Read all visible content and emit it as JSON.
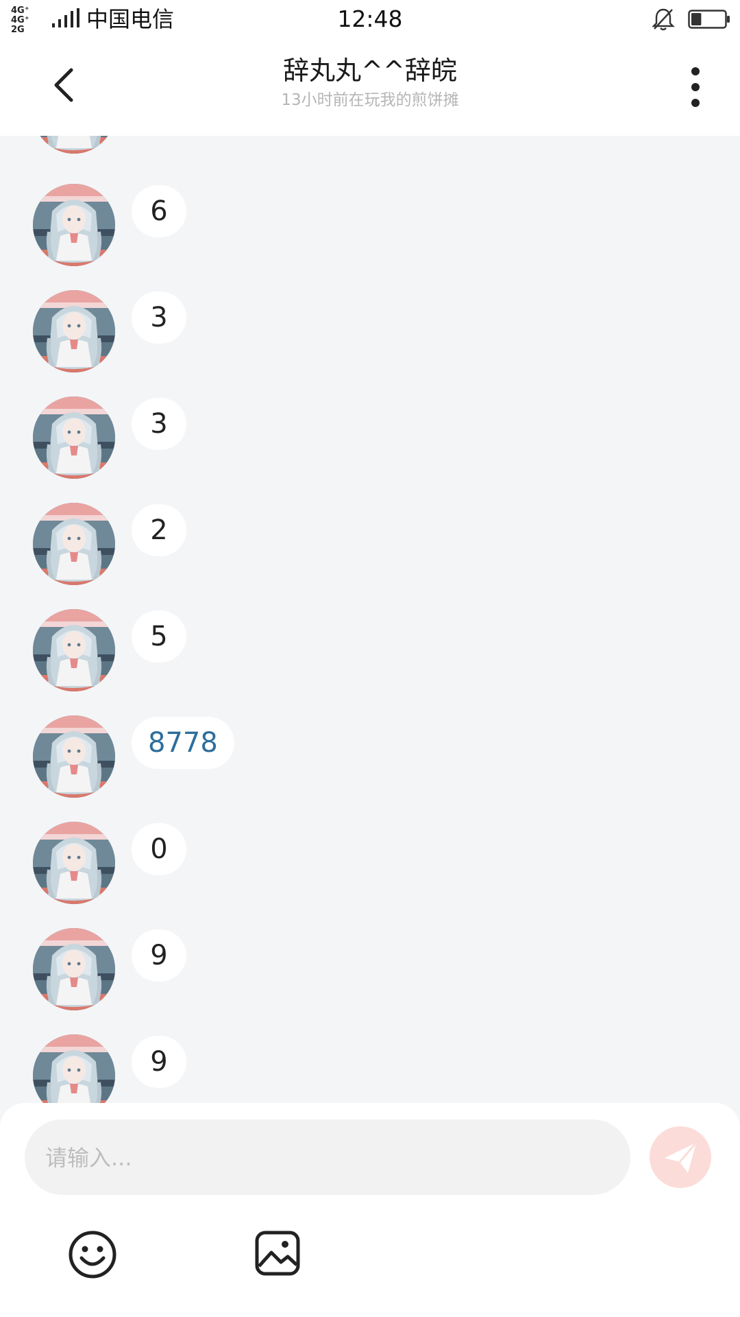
{
  "status_bar": {
    "network_top": "4G⁺ 4G⁺",
    "network_bottom": "2G",
    "carrier": "中国电信",
    "time": "12:48",
    "battery_level": 0.3,
    "icons": [
      "signal-icon",
      "bell-muted-icon",
      "battery-icon"
    ]
  },
  "header": {
    "title": "辞丸丸^^辞皖",
    "subtitle": "13小时前在玩我的煎饼摊",
    "icons": [
      "back-arrow-icon",
      "more-vertical-icon"
    ]
  },
  "messages": [
    {
      "text": "",
      "partial": true
    },
    {
      "text": "6"
    },
    {
      "text": "3"
    },
    {
      "text": "3"
    },
    {
      "text": "2"
    },
    {
      "text": "5"
    },
    {
      "text": "8778",
      "link": true
    },
    {
      "text": "0"
    },
    {
      "text": "9"
    },
    {
      "text": "9"
    }
  ],
  "composer": {
    "placeholder": "请输入...",
    "icons": [
      "send-icon",
      "emoji-icon",
      "image-icon"
    ]
  },
  "colors": {
    "background": "#f4f5f7",
    "bubble": "#ffffff",
    "link_text": "#2d6e9c",
    "send_button": "#fcdcd8",
    "subtitle": "#b5b5b5"
  }
}
